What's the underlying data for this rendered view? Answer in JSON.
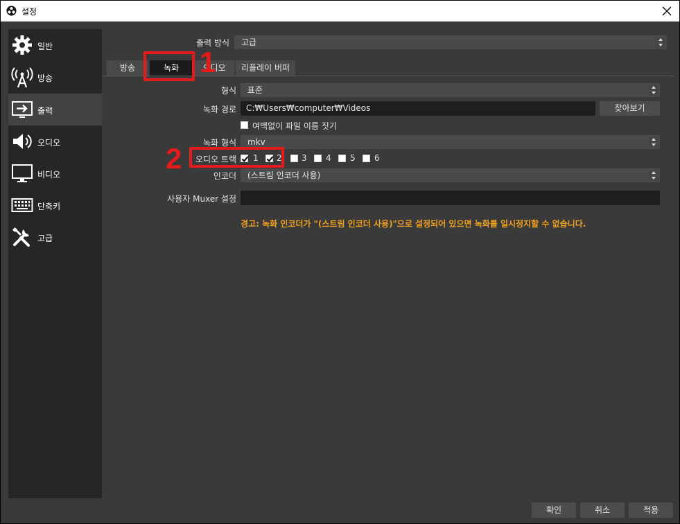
{
  "window": {
    "title": "설정"
  },
  "sidebar": {
    "items": [
      {
        "label": "일반",
        "icon": "gear-icon"
      },
      {
        "label": "방송",
        "icon": "antenna-icon"
      },
      {
        "label": "출력",
        "icon": "output-icon",
        "active": true
      },
      {
        "label": "오디오",
        "icon": "speaker-icon"
      },
      {
        "label": "비디오",
        "icon": "monitor-icon"
      },
      {
        "label": "단축키",
        "icon": "keyboard-icon"
      },
      {
        "label": "고급",
        "icon": "tools-icon"
      }
    ]
  },
  "output_mode": {
    "label": "출력 방식",
    "value": "고급"
  },
  "tabs": [
    {
      "label": "방송"
    },
    {
      "label": "녹화",
      "active": true
    },
    {
      "label": "오디오"
    },
    {
      "label": "리플레이 버퍼"
    }
  ],
  "recording": {
    "type_label": "형식",
    "type_value": "표준",
    "path_label": "녹화 경로",
    "path_value": "C:₩Users₩computer₩Videos",
    "browse_label": "찾아보기",
    "no_space_label": "여백없이 파일 이름 짓기",
    "format_label": "녹화 형식",
    "format_value": "mkv",
    "tracks_label": "오디오 트랙",
    "tracks": [
      {
        "label": "1",
        "checked": true
      },
      {
        "label": "2",
        "checked": true
      },
      {
        "label": "3",
        "checked": false
      },
      {
        "label": "4",
        "checked": false
      },
      {
        "label": "5",
        "checked": false
      },
      {
        "label": "6",
        "checked": false
      }
    ],
    "encoder_label": "인코더",
    "encoder_value": "(스트림 인코더 사용)",
    "muxer_label": "사용자 Muxer 설정",
    "muxer_value": "",
    "warning": "경고: 녹화 인코더가 \"(스트림 인코더 사용)\"으로 설정되어 있으면 녹화를 일시정지할 수 없습니다."
  },
  "annotations": [
    {
      "number": "1"
    },
    {
      "number": "2"
    }
  ],
  "footer": {
    "ok": "확인",
    "cancel": "취소",
    "apply": "적용"
  },
  "colors": {
    "warning": "#f0a020",
    "annotation": "#e31b1b",
    "panel": "#3a3a3a",
    "sidebar": "#262626"
  }
}
